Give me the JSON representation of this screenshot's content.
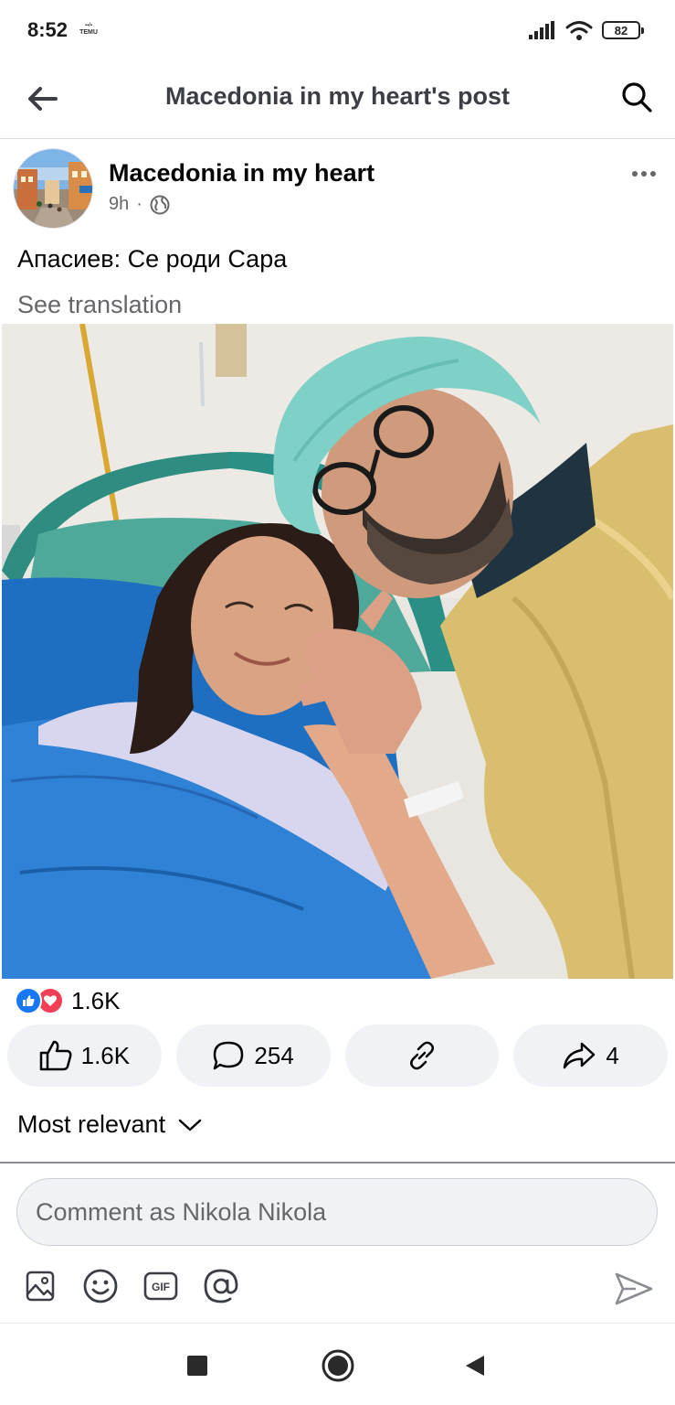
{
  "status_bar": {
    "time": "8:52",
    "temu_badge": "TEMU",
    "battery": "82"
  },
  "header": {
    "title": "Macedonia in my heart's post",
    "back_icon": "arrow-left-icon",
    "search_icon": "search-icon"
  },
  "post": {
    "author": "Macedonia in my heart",
    "time": "9h",
    "separator": "·",
    "audience_icon": "globe-icon",
    "text": "Апасиев: Се роди Сара",
    "see_translation": "See translation"
  },
  "reactions": {
    "count": "1.6K",
    "types": [
      "like",
      "love"
    ]
  },
  "actions": {
    "like_count": "1.6K",
    "comment_count": "254",
    "share_count": "4"
  },
  "comments": {
    "sort_label": "Most relevant",
    "input_placeholder": "Comment as Nikola Nikola"
  },
  "colors": {
    "accent": "#1877f2",
    "love": "#f33e58",
    "secondary_text": "#65676b",
    "button_bg": "#f0f2f5"
  }
}
